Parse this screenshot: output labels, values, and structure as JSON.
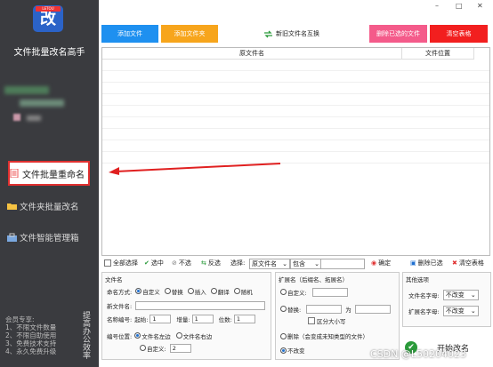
{
  "sidebar": {
    "logo_text": "改",
    "logo_tag": "LETOU",
    "app_title": "文件批量改名高手",
    "nav": [
      {
        "label": "文件批量重命名",
        "icon": "document-icon"
      },
      {
        "label": "文件夹批量改名",
        "icon": "folder-icon"
      },
      {
        "label": "文件智能管理箱",
        "icon": "toolbox-icon"
      }
    ],
    "member_title": "会员专享:",
    "member_items": [
      "1、不限文件数量",
      "2、不限自助使用",
      "3、免费技术支持",
      "4、永久免费升级"
    ],
    "vertical_text": "提高办公效率"
  },
  "window": {
    "minimize": "–",
    "maximize": "□",
    "close": "✕"
  },
  "top_buttons": {
    "add_file": "添加文件",
    "add_folder": "添加文件夹",
    "new_generate": "新旧文件名互换",
    "delete_selected": "删除已选的文件",
    "clear_table": "清空表格"
  },
  "table": {
    "headers": [
      "原文件名",
      "文件位置"
    ]
  },
  "toolbar": {
    "select_all": "全部选择",
    "select": "选中",
    "deselect": "不选",
    "invert": "反选",
    "select_label": "选择:",
    "select_field": "原文件名",
    "match_mode": "包含",
    "confirm": "确定",
    "delete_selected": "删除已选",
    "clear_table": "清空表格"
  },
  "filename_panel": {
    "title": "文件名",
    "mode_label": "命名方式:",
    "modes": [
      "自定义",
      "替换",
      "插入",
      "翻译",
      "随机"
    ],
    "new_name_label": "新文件名:",
    "numbering_label": "名称编号:",
    "start_label": "起始:",
    "start_value": "1",
    "step_label": "增量:",
    "step_value": "1",
    "digits_label": "位数:",
    "digits_value": "1",
    "position_label": "编号位置:",
    "positions": [
      "文件名左边",
      "文件名右边"
    ],
    "custom_label": "自定义:",
    "custom_value": "2"
  },
  "ext_panel": {
    "title": "扩展名（后缀名、拓展名）",
    "custom_label": "自定义:",
    "replace_label": "替换:",
    "replace_for": "为",
    "case_label": "区分大小写",
    "delete_label": "删除（会变成未知类型的文件）",
    "nochange_label": "不改变"
  },
  "other_panel": {
    "title": "其他选项",
    "name_case_label": "文件名字母:",
    "name_case_value": "不改变",
    "ext_case_label": "扩展名字母:",
    "ext_case_value": "不改变"
  },
  "start_button": "开始改名",
  "watermark": "CSDN @L50204023"
}
